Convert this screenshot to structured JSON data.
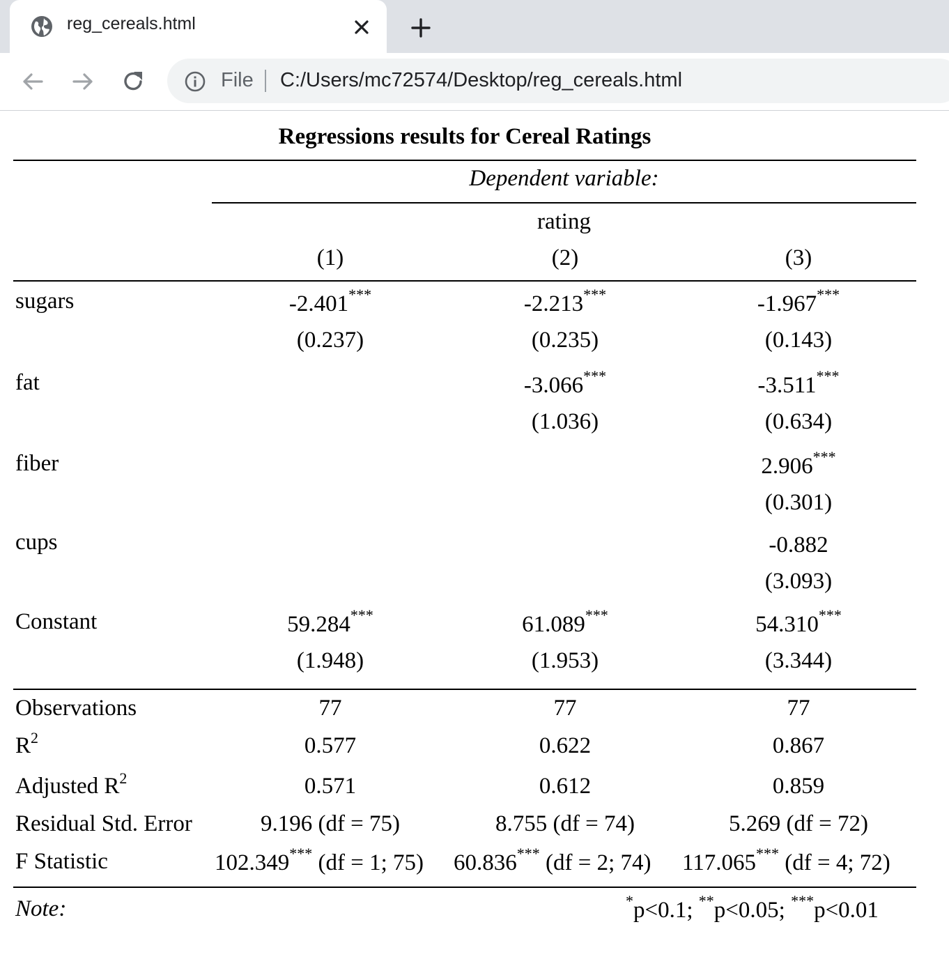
{
  "browser": {
    "tab_title": "reg_cereals.html",
    "address_scheme": "File",
    "address_url": "C:/Users/mc72574/Desktop/reg_cereals.html",
    "icons": [
      "globe-icon",
      "close-icon",
      "plus-icon",
      "back-arrow-icon",
      "forward-arrow-icon",
      "reload-icon",
      "info-icon"
    ]
  },
  "table": {
    "caption": "Regressions results for Cereal Ratings",
    "dep_var_header": "Dependent variable:",
    "dep_var_name": "rating",
    "columns": [
      "(1)",
      "(2)",
      "(3)"
    ],
    "rows": [
      {
        "label": "sugars",
        "coef": [
          "-2.401",
          "-2.213",
          "-1.967"
        ],
        "stars": [
          "***",
          "***",
          "***"
        ],
        "se": [
          "(0.237)",
          "(0.235)",
          "(0.143)"
        ]
      },
      {
        "label": "fat",
        "coef": [
          "",
          "-3.066",
          "-3.511"
        ],
        "stars": [
          "",
          "***",
          "***"
        ],
        "se": [
          "",
          "(1.036)",
          "(0.634)"
        ]
      },
      {
        "label": "fiber",
        "coef": [
          "",
          "",
          "2.906"
        ],
        "stars": [
          "",
          "",
          "***"
        ],
        "se": [
          "",
          "",
          "(0.301)"
        ]
      },
      {
        "label": "cups",
        "coef": [
          "",
          "",
          "-0.882"
        ],
        "stars": [
          "",
          "",
          ""
        ],
        "se": [
          "",
          "",
          "(3.093)"
        ]
      },
      {
        "label": "Constant",
        "coef": [
          "59.284",
          "61.089",
          "54.310"
        ],
        "stars": [
          "***",
          "***",
          "***"
        ],
        "se": [
          "(1.948)",
          "(1.953)",
          "(3.344)"
        ]
      }
    ],
    "stats": {
      "observations_label": "Observations",
      "observations": [
        "77",
        "77",
        "77"
      ],
      "r2_label": "R",
      "r2_sup": "2",
      "r2": [
        "0.577",
        "0.622",
        "0.867"
      ],
      "adj_r2_label": "Adjusted R",
      "adj_r2_sup": "2",
      "adj_r2": [
        "0.571",
        "0.612",
        "0.859"
      ],
      "rse_label": "Residual Std. Error",
      "rse": [
        "9.196 (df = 75)",
        "8.755 (df = 74)",
        "5.269 (df = 72)"
      ],
      "f_label": "F Statistic",
      "f_values": [
        "102.349",
        "60.836",
        "117.065"
      ],
      "f_stars": [
        "***",
        "***",
        "***"
      ],
      "f_df": [
        "(df = 1; 75)",
        "(df = 2; 74)",
        "(df = 4; 72)"
      ]
    },
    "note_label": "Note:",
    "note": {
      "s1": "*",
      "t1": "p<0.1;",
      "s2": "**",
      "t2": "p<0.05;",
      "s3": "***",
      "t3": "p<0.01"
    }
  }
}
